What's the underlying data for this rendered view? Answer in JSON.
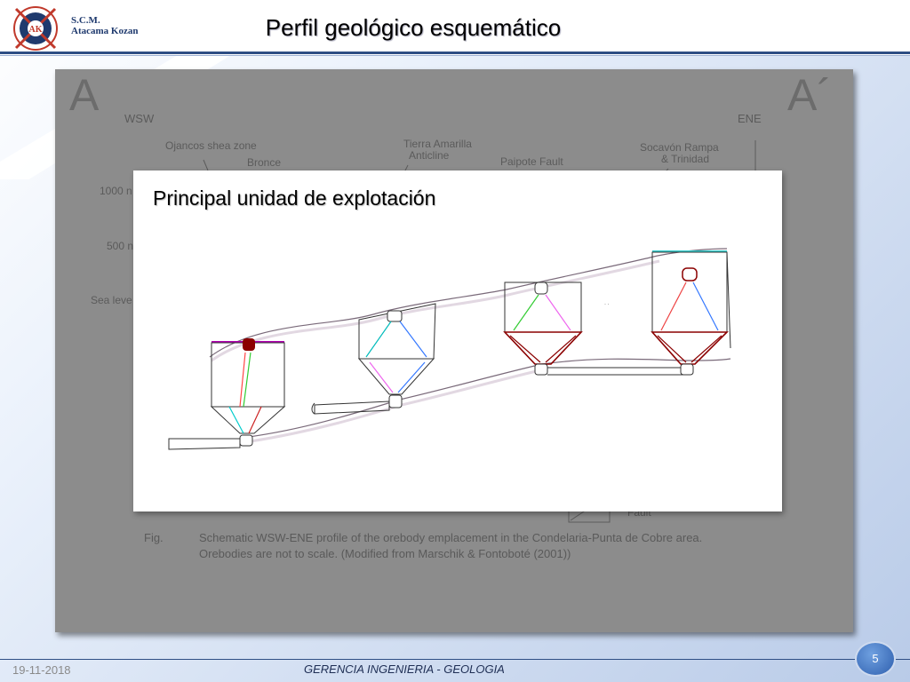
{
  "header": {
    "logo_line1": "S.C.M.",
    "logo_line2": "Atacama Kozan",
    "logo_mark": "AK",
    "title": "Perfil geológico esquemático"
  },
  "figure": {
    "corner_left": "A",
    "corner_right": "A´",
    "dir_left": "WSW",
    "dir_right": "ENE",
    "labels": {
      "ojancos": "Ojancos shea zone",
      "bronce": "Bronce",
      "tierra_amarilla": "Tierra Amarilla",
      "anticline": "Anticline",
      "paipote": "Paipote Fault",
      "socavon": "Socavón Rampa",
      "trinidad": "& Trinidad",
      "elev_1000": "1000 n",
      "elev_500": "500 n",
      "sea_level": "Sea leve",
      "fault": "Fault"
    },
    "caption_prefix": "Fig.",
    "caption_line1": "Schematic WSW-ENE profile of the orebody emplacement in the Condelaria-Punta de Cobre area.",
    "caption_line2": "Orebodies are not to scale. (Modified from Marschik & Fontoboté (2001))"
  },
  "inset": {
    "title": "Principal unidad de explotación"
  },
  "footer": {
    "date": "19-11-2018",
    "center": "GERENCIA INGENIERIA - GEOLOGIA",
    "page": "5"
  },
  "colors": {
    "accent": "#2e4e84",
    "figure_bg": "#8c8c8c"
  }
}
